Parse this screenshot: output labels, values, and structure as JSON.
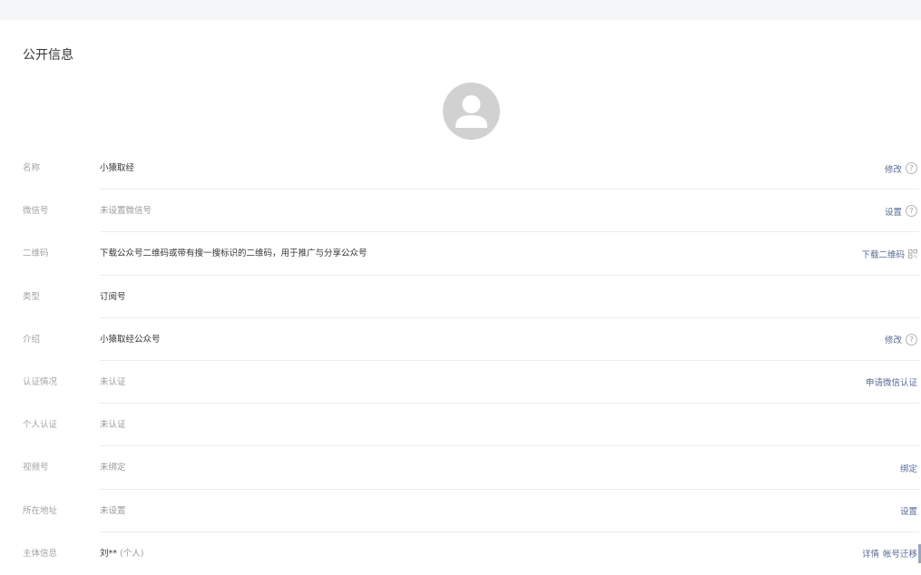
{
  "section": {
    "title": "公开信息"
  },
  "avatar": {
    "icon": "user-silhouette-icon"
  },
  "colors": {
    "link": "#576b95",
    "label": "#a3a3a3",
    "text": "#353535",
    "muted": "#9a9a9a",
    "divider": "#ececec",
    "avatar_bg": "#d1d1d1"
  },
  "rows": [
    {
      "label": "名称",
      "value": "小猿取经",
      "actions": [
        {
          "text": "修改"
        }
      ],
      "help": "?"
    },
    {
      "label": "微信号",
      "value": "未设置微信号",
      "actions": [
        {
          "text": "设置"
        }
      ],
      "help": "?"
    },
    {
      "label": "二维码",
      "value": "下载公众号二维码或带有搜一搜标识的二维码，用于推广与分享公众号",
      "actions": [
        {
          "text": "下载二维码"
        }
      ],
      "icon": "qr-code-icon"
    },
    {
      "label": "类型",
      "value": "订阅号"
    },
    {
      "label": "介绍",
      "value": "小猿取经公众号",
      "actions": [
        {
          "text": "修改"
        }
      ],
      "help": "?"
    },
    {
      "label": "认证情况",
      "value": "未认证",
      "actions": [
        {
          "text": "申请微信认证"
        }
      ]
    },
    {
      "label": "个人认证",
      "value": "未认证"
    },
    {
      "label": "视频号",
      "value": "未绑定",
      "actions": [
        {
          "text": "绑定"
        }
      ]
    },
    {
      "label": "所在地址",
      "value": "未设置",
      "actions": [
        {
          "text": "设置"
        }
      ]
    },
    {
      "label": "主体信息",
      "value": "刘**",
      "value_suffix": "(个人)",
      "actions": [
        {
          "text": "详情"
        },
        {
          "text": "帐号迁移"
        }
      ]
    }
  ]
}
